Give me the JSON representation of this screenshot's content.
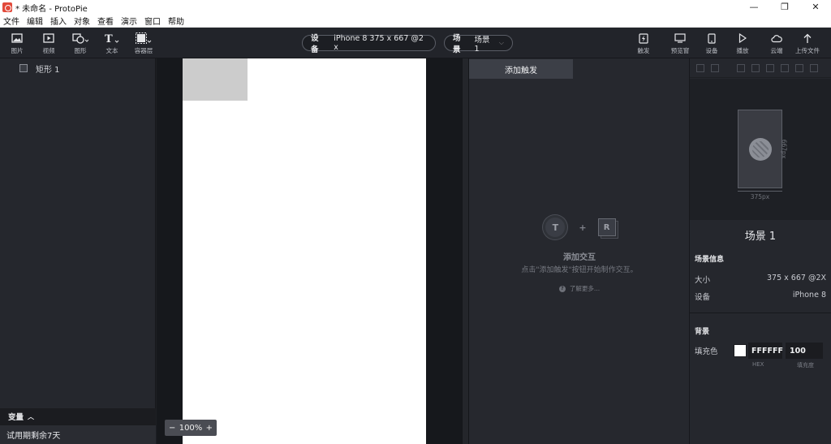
{
  "window": {
    "title": "* 未命名 - ProtoPie",
    "min_glyph": "—",
    "max_glyph": "❐",
    "close_glyph": "✕"
  },
  "menu": [
    "文件",
    "编辑",
    "插入",
    "对象",
    "查看",
    "演示",
    "窗口",
    "帮助"
  ],
  "toolbar": {
    "left_tools": [
      {
        "label": "图片",
        "icon": "image-icon"
      },
      {
        "label": "视频",
        "icon": "video-icon"
      },
      {
        "label": "图形",
        "icon": "shape-icon"
      },
      {
        "label": "文本",
        "icon": "text-icon"
      },
      {
        "label": "容器层",
        "icon": "container-icon"
      }
    ],
    "device": {
      "key": "设备",
      "value": "iPhone 8  375 x 667  @2 x"
    },
    "scene": {
      "key": "场景",
      "value": "场景 1"
    },
    "right_tools": [
      {
        "label": "触发",
        "icon": "trigger-icon"
      },
      {
        "label": "预览窗",
        "icon": "preview-window-icon"
      },
      {
        "label": "设备",
        "icon": "device-icon"
      },
      {
        "label": "播放",
        "icon": "play-icon"
      },
      {
        "label": "云端",
        "icon": "cloud-icon"
      },
      {
        "label": "上传文件",
        "icon": "upload-icon"
      }
    ]
  },
  "layers": [
    {
      "name": "矩形 1"
    }
  ],
  "variables_label": "变量",
  "trial_text": "试用期剩余7天",
  "canvas": {
    "zoom": "100%",
    "zoom_minus": "−",
    "zoom_plus": "+"
  },
  "interaction": {
    "add_trigger": "添加触发",
    "trigger_letter": "T",
    "response_letter": "R",
    "plus": "+",
    "empty_title": "添加交互",
    "empty_desc": "点击\"添加触发\"按钮开始制作交互。",
    "learn_more": "了解更多..."
  },
  "properties": {
    "width_label": "375px",
    "height_label": "667px",
    "scene_name": "场景 1",
    "scene_info_title": "场景信息",
    "size_key": "大小",
    "size_value": "375 x 667 @2X",
    "device_key": "设备",
    "device_value": "iPhone 8",
    "background_title": "背景",
    "fill_label": "填充色",
    "fill_color": "#FFFFFF",
    "hex_value": "FFFFFF",
    "opacity_value": "100",
    "hex_caption": "HEX",
    "opacity_caption": "填充度"
  }
}
